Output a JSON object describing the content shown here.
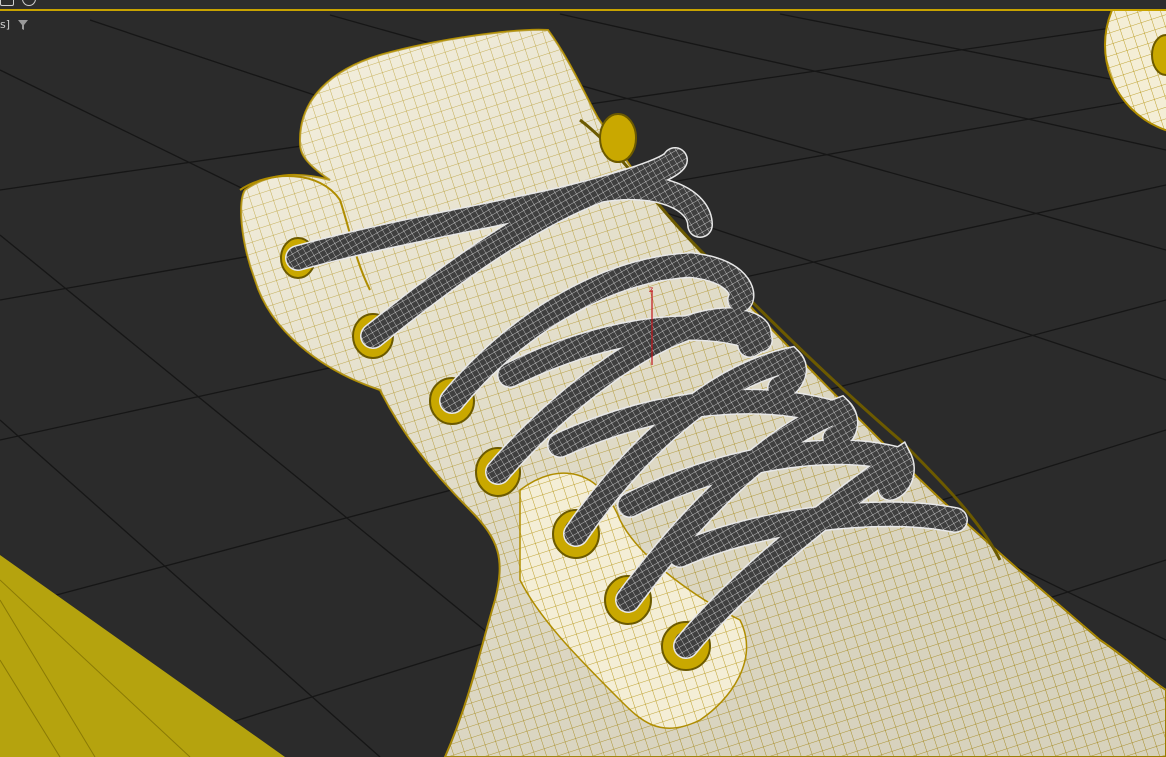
{
  "viewport": {
    "label": "s]",
    "filter_icon": "filter-icon",
    "colors": {
      "background": "#262626",
      "grid_line": "#161616",
      "grid_floor": "#2f2f2f",
      "selection_wire": "#b08d00",
      "shoe_surface": "#f3ecd3",
      "lace": "#3f3f3f",
      "lace_wire": "#e8e8e8",
      "eyelet": "#c9a800",
      "floor_object": "#b5a30e"
    }
  }
}
